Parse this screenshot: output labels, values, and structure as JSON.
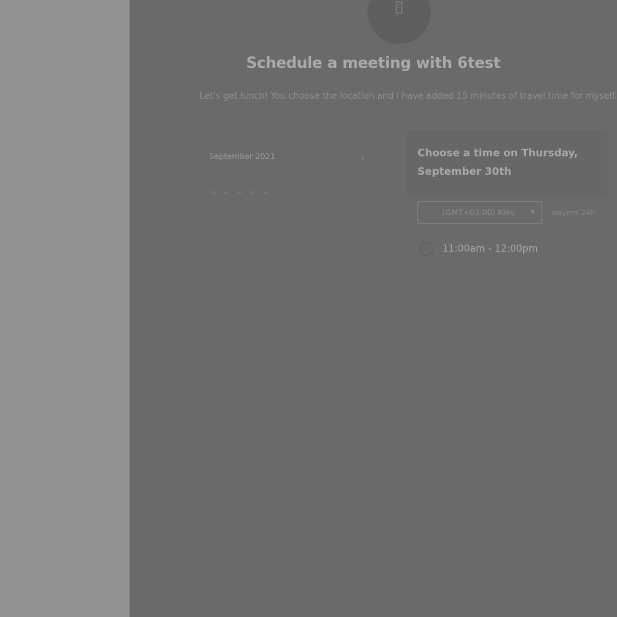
{
  "header": {
    "title": "Schedule a meeting with 6test",
    "subtitle": "Let’s get lunch! You choose the location and I have added 15 minutes of travel time for myself."
  },
  "calendar": {
    "month_label": "September 2021",
    "next_icon": "chevron-right-icon"
  },
  "time_panel": {
    "title": "Choose a time on Thursday, September 30th",
    "timezone_value": "(GMT+03:00) Kiev",
    "format_toggle": "am/pm  24h",
    "slots": [
      {
        "label": "11:00am - 12:00pm"
      }
    ]
  },
  "colors": {
    "overlay_main": "#6a6a6a",
    "overlay_sidebar": "#929292"
  }
}
